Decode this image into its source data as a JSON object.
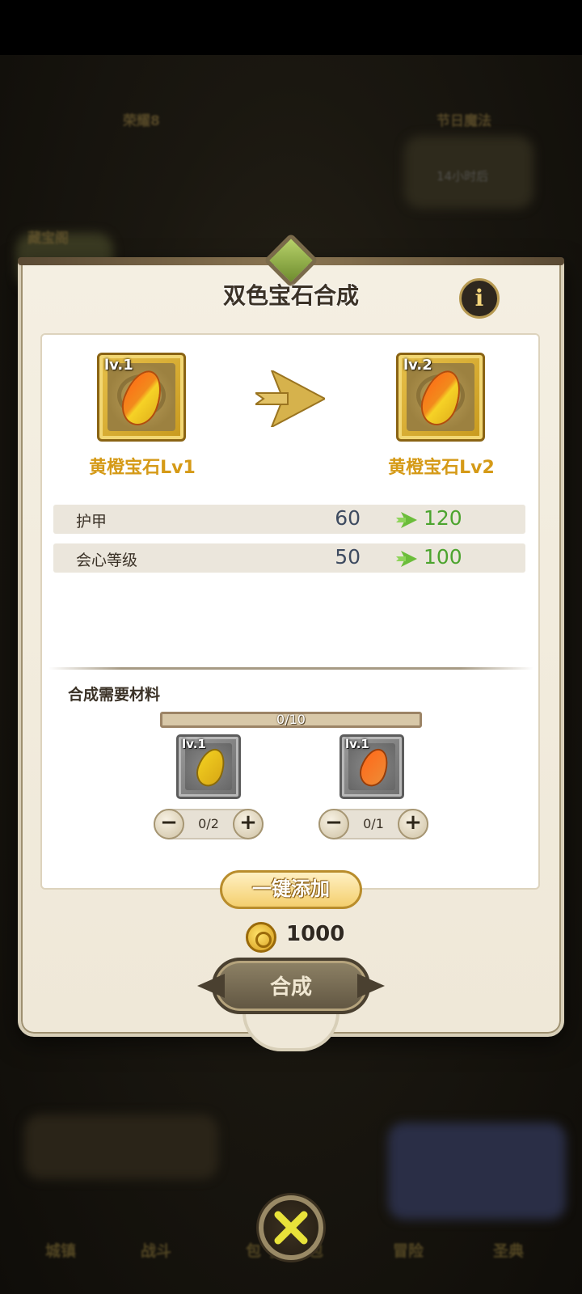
{
  "background": {
    "labels": [
      "荣耀8",
      "节日魔法",
      "14小时后",
      "藏宝阁"
    ],
    "bottom_nav": [
      "城镇",
      "战斗",
      "包 子 背 包",
      "冒险",
      "圣典"
    ]
  },
  "dialog": {
    "title": "双色宝石合成",
    "info_icon": "info-icon",
    "source": {
      "level": "lv.1",
      "name": "黄橙宝石Lv1"
    },
    "result": {
      "level": "lv.2",
      "name": "黄橙宝石Lv2"
    },
    "stats": [
      {
        "name": "护甲",
        "from": "60",
        "to": "120"
      },
      {
        "name": "会心等级",
        "from": "50",
        "to": "100"
      }
    ],
    "materials_label": "合成需要材料",
    "progress": {
      "text": "0/10",
      "fraction": 0.0
    },
    "materials": [
      {
        "level": "lv.1",
        "color": "yellow",
        "count": "0/2"
      },
      {
        "level": "lv.1",
        "color": "orange",
        "count": "0/1"
      }
    ],
    "one_click_label": "一键添加",
    "cost": "1000",
    "craft_label": "合成"
  },
  "colors": {
    "accent_gold": "#d59a17",
    "stat_increase": "#4ca42e",
    "stat_old": "#3e4b60",
    "panel_bg": "#f4efe2"
  }
}
